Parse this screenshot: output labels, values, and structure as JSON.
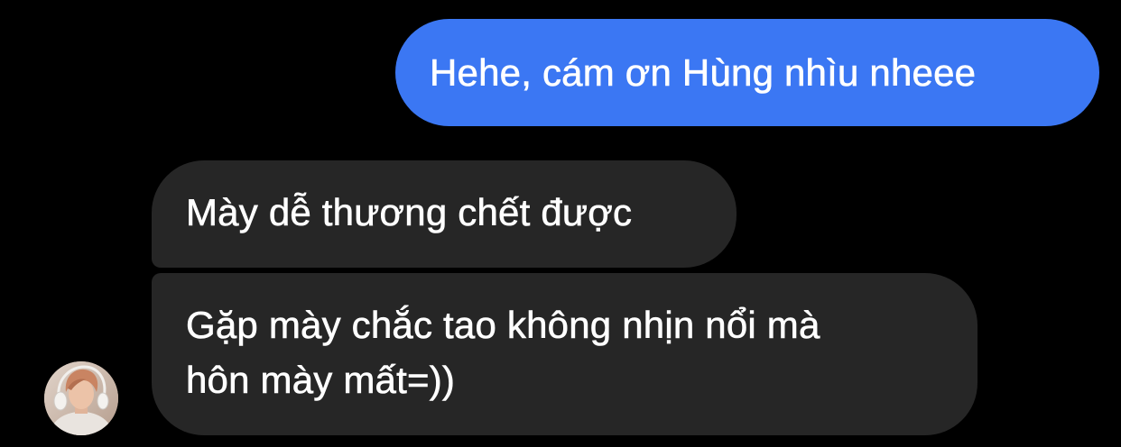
{
  "conversation": {
    "messages": [
      {
        "direction": "outgoing",
        "lines": [
          "Hehe, cám ơn Hùng nhìu nheee"
        ]
      },
      {
        "direction": "incoming",
        "lines": [
          "Mày dễ thương chết được"
        ]
      },
      {
        "direction": "incoming",
        "lines": [
          "Gặp mày chắc tao không nhịn nổi mà",
          "hôn mày mất=))"
        ]
      }
    ],
    "avatar": {
      "icon": "contact-avatar-photo"
    }
  },
  "theme": {
    "background": "#000000",
    "outgoing_bubble": "#3b77f3",
    "incoming_bubble": "#262626",
    "text": "#ffffff"
  }
}
